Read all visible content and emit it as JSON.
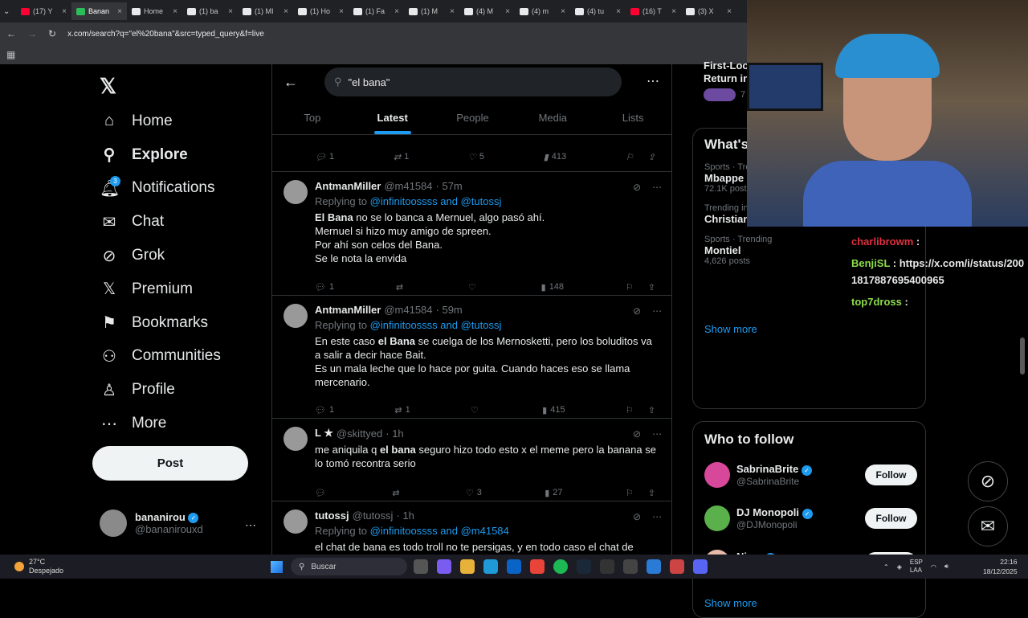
{
  "browser": {
    "tabs": [
      {
        "label": "(17) Y",
        "color": "#ff0033"
      },
      {
        "label": "Banan",
        "color": "#2bbf5a"
      },
      {
        "label": "Home",
        "color": "#e7e9ea"
      },
      {
        "label": "(1) ba",
        "color": "#e7e9ea"
      },
      {
        "label": "(1) MI",
        "color": "#e7e9ea"
      },
      {
        "label": "(1) Ho",
        "color": "#e7e9ea"
      },
      {
        "label": "(1) Fa",
        "color": "#e7e9ea"
      },
      {
        "label": "(1) M",
        "color": "#e7e9ea"
      },
      {
        "label": "(4) M",
        "color": "#e7e9ea"
      },
      {
        "label": "(4) m",
        "color": "#e7e9ea"
      },
      {
        "label": "(4) tu",
        "color": "#e7e9ea"
      },
      {
        "label": "(16) T",
        "color": "#ff0033"
      },
      {
        "label": "(3) X",
        "color": "#e7e9ea"
      }
    ],
    "url": "x.com/search?q=\"el%20bana\"&src=typed_query&f=live"
  },
  "sidebar": {
    "logo": "𝕏",
    "items": [
      {
        "label": "Home",
        "icon": "⌂",
        "name": "home"
      },
      {
        "label": "Explore",
        "icon": "⚲",
        "name": "explore"
      },
      {
        "label": "Notifications",
        "icon": "🔔︎",
        "name": "notifications"
      },
      {
        "label": "Chat",
        "icon": "✉",
        "name": "chat"
      },
      {
        "label": "Grok",
        "icon": "⊘",
        "name": "grok"
      },
      {
        "label": "Premium",
        "icon": "𝕏",
        "name": "premium"
      },
      {
        "label": "Bookmarks",
        "icon": "⚑",
        "name": "bookmarks"
      },
      {
        "label": "Communities",
        "icon": "⚇",
        "name": "communities"
      },
      {
        "label": "Profile",
        "icon": "♙",
        "name": "profile"
      },
      {
        "label": "More",
        "icon": "⋯",
        "name": "more"
      }
    ],
    "notif_count": "3",
    "post_label": "Post",
    "account": {
      "name": "bananirou",
      "handle": "@bananirouxd"
    }
  },
  "search": {
    "query": "\"el bana\"",
    "tabs": [
      "Top",
      "Latest",
      "People",
      "Media",
      "Lists"
    ],
    "active_tab": "Latest"
  },
  "feed": {
    "top_actions": {
      "replies": "1",
      "reposts": "1",
      "likes": "5",
      "views": "413"
    },
    "tweets": [
      {
        "name": "AntmanMiller",
        "handle": "@m41584",
        "time": "· 57m",
        "replying_prefix": "Replying to",
        "replying_to": "@infinitoossss and @tutossj",
        "lines": [
          [
            "El Bana",
            " no se lo banca a Mernuel, algo pasó ahí."
          ],
          [
            "",
            "Mernuel si hizo muy amigo de spreen."
          ],
          [
            "",
            "Por ahí son celos del Bana."
          ],
          [
            "",
            "Se le nota la envida"
          ]
        ],
        "replies": "1",
        "reposts": "",
        "likes": "",
        "views": "148"
      },
      {
        "name": "AntmanMiller",
        "handle": "@m41584",
        "time": "· 59m",
        "replying_prefix": "Replying to",
        "replying_to": "@infinitoossss and @tutossj",
        "text_pre": "En este caso ",
        "text_bold": "el Bana",
        "text_post": " se cuelga de los Mernosketti, pero los boluditos va a salir a decir hace Bait.\nEs un mala leche que lo hace por guita. Cuando haces eso se llama mercenario.",
        "replies": "1",
        "reposts": "1",
        "likes": "",
        "views": "415"
      },
      {
        "name": "L ★",
        "handle": "@skittyed",
        "time": "· 1h",
        "text_pre": "me aniquila q ",
        "text_bold": "el bana",
        "text_post": " seguro hizo todo esto x el meme pero la banana se lo tomó recontra serio",
        "replies": "",
        "reposts": "",
        "likes": "3",
        "views": "27"
      },
      {
        "name": "tutossj",
        "handle": "@tutossj",
        "time": "· 1h",
        "replying_prefix": "Replying to",
        "replying_to": "@infinitoossss and @m41584",
        "text_pre": "el chat de bana es todo troll no te persigas, y en todo caso el chat de",
        "text_bold": "",
        "text_post": ""
      }
    ]
  },
  "right": {
    "partial_title": "First-Loo\nReturn in",
    "partial_count": "7",
    "trends_title": "What's",
    "trends": [
      {
        "cat": "Sports · Trending",
        "name": "Mbappe",
        "count": "72.1K posts"
      },
      {
        "cat": "Trending in Argentina",
        "name": "Christian Petersen",
        "count": ""
      },
      {
        "cat": "Sports · Trending",
        "name": "Montiel",
        "count": "4,626 posts"
      }
    ],
    "show_more": "Show more",
    "wtf_title": "Who to follow",
    "follow": [
      {
        "name": "SabrinaBrite",
        "handle": "@SabrinaBrite",
        "color": "#d8489a"
      },
      {
        "name": "DJ Monopoli",
        "handle": "@DJMonopoli",
        "color": "#5ab04a"
      },
      {
        "name": "Nimu",
        "handle": "@NimuVt",
        "color": "#e8b8a8"
      }
    ],
    "follow_label": "Follow",
    "wtf_show_more": "Show more"
  },
  "stream_chat": [
    {
      "user": "charlibrowm",
      "text": ":"
    },
    {
      "user": "BenjiSL",
      "text": ": https://x.com/i/status/2001817887695400965"
    },
    {
      "user": "top7dross",
      "text": ":"
    }
  ],
  "taskbar": {
    "temp": "27°C",
    "weather": "Despejado",
    "search": "Buscar",
    "lang": "ESP\nLAA",
    "time": "22:16",
    "date": "18/12/2025"
  }
}
